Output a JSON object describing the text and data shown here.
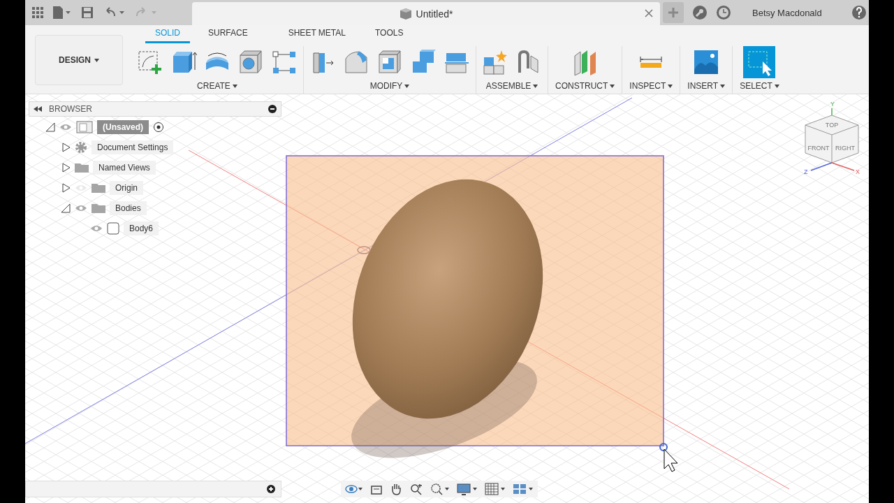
{
  "document_tab": {
    "title": "Untitled*"
  },
  "user": {
    "name": "Betsy Macdonald"
  },
  "workspace": {
    "label": "DESIGN"
  },
  "tabs": [
    {
      "label": "SOLID",
      "selected": true
    },
    {
      "label": "SURFACE",
      "selected": false
    },
    {
      "label": "SHEET METAL",
      "selected": false
    },
    {
      "label": "TOOLS",
      "selected": false
    }
  ],
  "tool_groups": [
    {
      "label": "CREATE",
      "kind": "create"
    },
    {
      "label": "MODIFY",
      "kind": "modify"
    },
    {
      "label": "ASSEMBLE",
      "kind": "assemble"
    },
    {
      "label": "CONSTRUCT",
      "kind": "construct"
    },
    {
      "label": "INSPECT",
      "kind": "inspect"
    },
    {
      "label": "INSERT",
      "kind": "insert"
    },
    {
      "label": "SELECT",
      "kind": "select"
    }
  ],
  "browser": {
    "title": "BROWSER",
    "tree": [
      {
        "label": "(Unsaved)",
        "kind": "component",
        "selected": true,
        "expanded": true,
        "visible": true,
        "children": [
          {
            "label": "Document Settings",
            "kind": "settings",
            "selected": false,
            "expanded": false
          },
          {
            "label": "Named Views",
            "kind": "folder",
            "selected": false,
            "expanded": false
          },
          {
            "label": "Origin",
            "kind": "folder",
            "selected": false,
            "expanded": false,
            "visible": false
          },
          {
            "label": "Bodies",
            "kind": "folder",
            "selected": false,
            "expanded": true,
            "visible": true,
            "children": [
              {
                "label": "Body6",
                "kind": "body",
                "selected": false,
                "visible": true
              }
            ]
          }
        ]
      }
    ]
  },
  "view_cube": {
    "faces": [
      "TOP",
      "FRONT",
      "RIGHT"
    ],
    "axes": [
      "Y",
      "Z",
      "X"
    ]
  }
}
